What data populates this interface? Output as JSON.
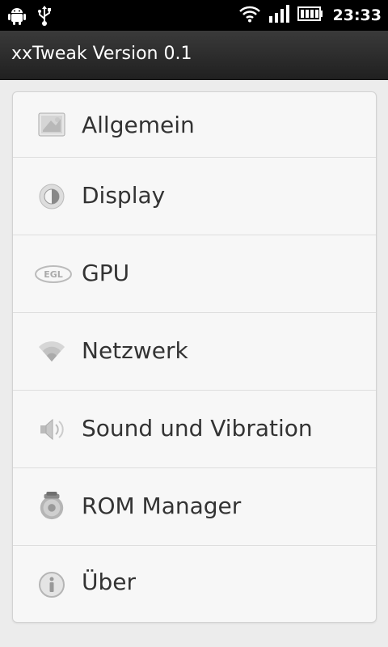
{
  "status_bar": {
    "time": "23:33",
    "icons": [
      "android-icon",
      "usb-icon",
      "wifi-icon",
      "signal-icon",
      "battery-icon"
    ]
  },
  "app": {
    "title": "xxTweak Version 0.1"
  },
  "menu": {
    "items": [
      {
        "label": "Allgemein",
        "icon": "settings-slider-icon"
      },
      {
        "label": "Display",
        "icon": "brightness-icon"
      },
      {
        "label": "GPU",
        "icon": "egl-icon"
      },
      {
        "label": "Netzwerk",
        "icon": "wifi-icon"
      },
      {
        "label": "Sound und Vibration",
        "icon": "speaker-icon"
      },
      {
        "label": "ROM Manager",
        "icon": "rom-manager-icon"
      },
      {
        "label": "Über",
        "icon": "info-icon"
      }
    ]
  }
}
